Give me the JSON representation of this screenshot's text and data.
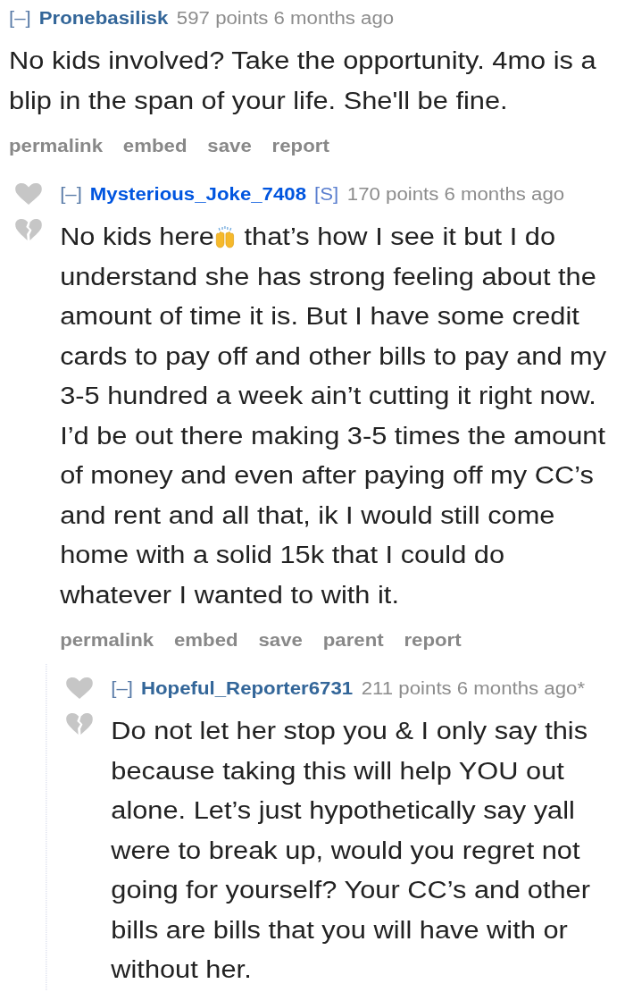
{
  "comments": [
    {
      "collapse_toggle": "[–]",
      "author": "Pronebasilisk",
      "is_submitter": false,
      "score": "597 points",
      "time": "6 months ago",
      "vote_icons": false,
      "body": [
        {
          "kind": "text",
          "text": "No kids involved? Take the opportunity. 4mo is a blip in the span of your life. She'll be fine."
        }
      ],
      "actions": [
        "permalink",
        "embed",
        "save",
        "report"
      ],
      "children": [
        {
          "collapse_toggle": "[–]",
          "author": "Mysterious_Joke_7408",
          "is_submitter": true,
          "submitter_tag": "[S]",
          "score": "170 points",
          "time": "6 months ago",
          "vote_icons": true,
          "body": [
            {
              "kind": "text",
              "text": "No kids here"
            },
            {
              "kind": "emoji"
            },
            {
              "kind": "text",
              "text": " that’s how I see it but I do understand she has strong feeling about the amount of time it is. But I have some credit cards to pay off and other bills to pay and my 3-5 hundred a week ain’t cutting it right now. I’d be out there making 3-5 times the amount of money and even after paying off my CC’s and rent and all that, ik I would still come home with a solid 15k that I could do whatever I wanted to with it."
            }
          ],
          "actions": [
            "permalink",
            "embed",
            "save",
            "parent",
            "report"
          ],
          "children": [
            {
              "collapse_toggle": "[–]",
              "author": "Hopeful_Reporter6731",
              "is_submitter": false,
              "score": "211 points",
              "time": "6 months ago*",
              "vote_icons": true,
              "body": [
                {
                  "kind": "text",
                  "text": "Do not let her stop you & I only say this because taking this will help YOU out alone. Let’s just hypothetically say yall were to break up, would you regret not going for yourself? Your CC’s and other bills are bills that you will have with or without her."
                }
              ]
            }
          ]
        }
      ]
    }
  ]
}
